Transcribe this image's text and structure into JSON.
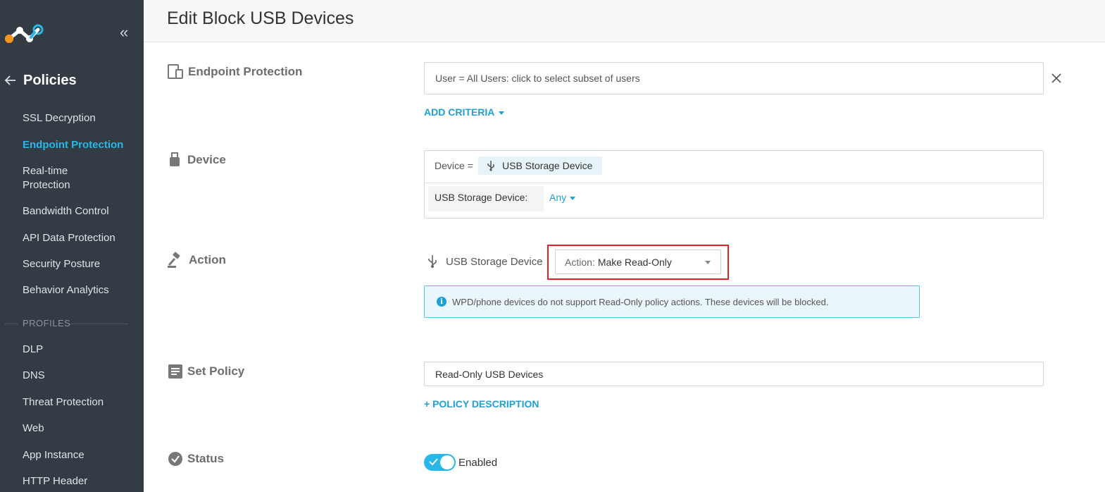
{
  "app": {
    "page_title": "Edit Block USB Devices"
  },
  "sidebar": {
    "section_title": "Policies",
    "items": [
      {
        "label": "SSL Decryption"
      },
      {
        "label": "Endpoint Protection"
      },
      {
        "label": "Real-time Protection"
      },
      {
        "label": "Bandwidth Control"
      },
      {
        "label": "API Data Protection"
      },
      {
        "label": "Security Posture"
      },
      {
        "label": "Behavior Analytics"
      }
    ],
    "profiles_label": "PROFILES",
    "profiles": [
      {
        "label": "DLP"
      },
      {
        "label": "DNS"
      },
      {
        "label": "Threat Protection"
      },
      {
        "label": "Web"
      },
      {
        "label": "App Instance"
      },
      {
        "label": "HTTP Header"
      }
    ]
  },
  "sections": {
    "endpoint": {
      "label": "Endpoint Protection",
      "user_field": "User = All Users: click to select subset of users",
      "add_criteria": "ADD CRITERIA"
    },
    "device": {
      "label": "Device",
      "device_prefix": "Device =",
      "device_chip": "USB Storage Device",
      "storage_label": "USB Storage Device:",
      "storage_value": "Any"
    },
    "action": {
      "label": "Action",
      "device_name": "USB Storage Device",
      "select_label": "Action:",
      "select_value": "Make Read-Only",
      "info_text": "WPD/phone devices do not support Read-Only policy actions. These devices will be blocked."
    },
    "set_policy": {
      "label": "Set Policy",
      "policy_name": "Read-Only USB Devices",
      "description_link": "+ POLICY DESCRIPTION"
    },
    "status": {
      "label": "Status",
      "toggle_label": "Enabled",
      "enabled": true
    }
  },
  "colors": {
    "sidebar_bg": "#333c44",
    "accent": "#29b6e9",
    "link": "#1e9fd6",
    "highlight": "#e0202a"
  }
}
